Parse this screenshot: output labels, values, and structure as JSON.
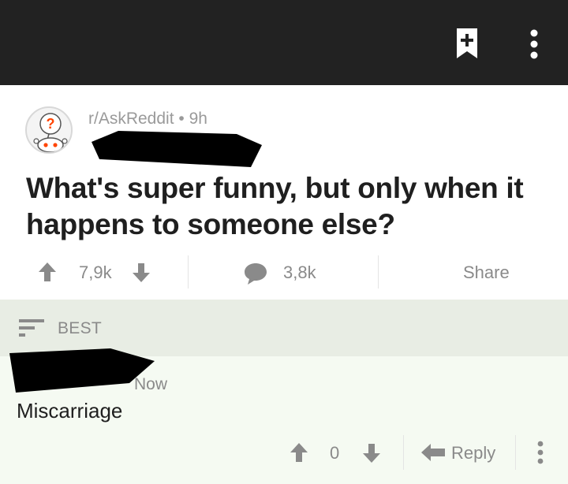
{
  "toolbar": {
    "save_icon": "bookmark-plus-icon",
    "overflow_icon": "more-vertical-icon",
    "background": "#222222"
  },
  "post": {
    "subreddit": "r/AskReddit",
    "separator": "•",
    "age": "9h",
    "author_redacted": true,
    "title": "What's super funny, but only when it happens to someone else?",
    "upvotes": "7,9k",
    "comments": "3,8k",
    "share_label": "Share"
  },
  "sort": {
    "label": "BEST",
    "icon": "sort-icon"
  },
  "comment": {
    "author_redacted": true,
    "age": "Now",
    "body": "Miscarriage",
    "score": "0",
    "reply_label": "Reply"
  },
  "colors": {
    "sort_bar": "#e8ede4",
    "comment_bg": "#f5faf2",
    "muted_text": "#8a8a8a",
    "accent": "#3b9ad9"
  }
}
